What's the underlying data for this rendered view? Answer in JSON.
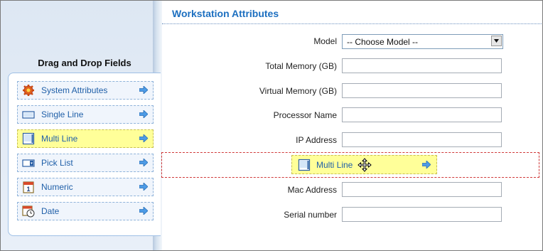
{
  "left_panel": {
    "title": "Drag and Drop Fields",
    "items": [
      {
        "label": "System Attributes",
        "icon": "gear-icon",
        "highlighted": false
      },
      {
        "label": "Single Line",
        "icon": "single-line-icon",
        "highlighted": false
      },
      {
        "label": "Multi Line",
        "icon": "multi-line-icon",
        "highlighted": true
      },
      {
        "label": "Pick List",
        "icon": "pick-list-icon",
        "highlighted": false
      },
      {
        "label": "Numeric",
        "icon": "numeric-icon",
        "highlighted": false
      },
      {
        "label": "Date",
        "icon": "date-icon",
        "highlighted": false
      }
    ]
  },
  "form": {
    "title": "Workstation Attributes",
    "model": {
      "label": "Model",
      "selected": "-- Choose Model --"
    },
    "fields": [
      {
        "label": "Total Memory (GB)",
        "value": ""
      },
      {
        "label": "Virtual Memory (GB)",
        "value": ""
      },
      {
        "label": "Processor Name",
        "value": ""
      },
      {
        "label": "IP Address",
        "value": ""
      },
      {
        "label": "Mac Address",
        "value": ""
      },
      {
        "label": "Serial number",
        "value": ""
      }
    ],
    "dragged_item": {
      "label": "Multi Line",
      "icon": "multi-line-icon"
    }
  },
  "colors": {
    "title_blue": "#1c6fc0",
    "item_text": "#1f5fa8",
    "highlight": "#ffff99",
    "drop_border": "#d03a3a"
  }
}
